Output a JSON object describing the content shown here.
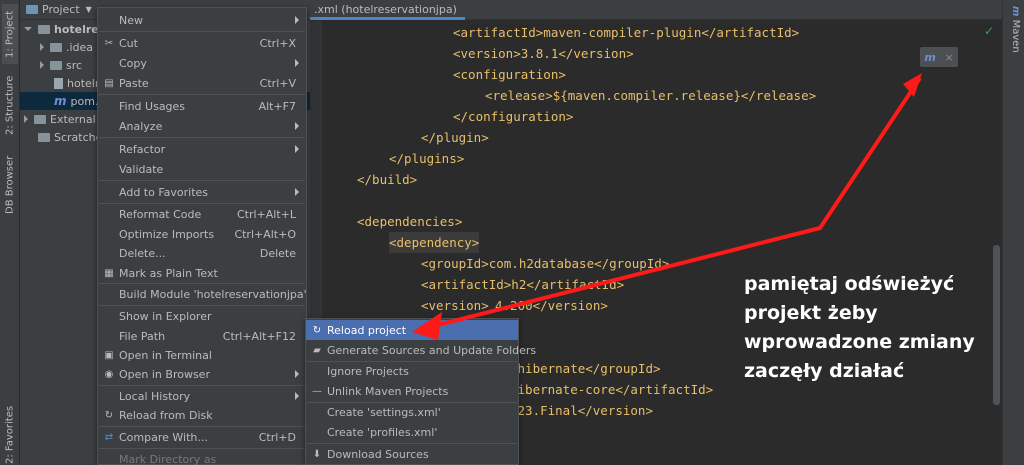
{
  "left_stripe": {
    "project_tab": "1: Project",
    "structure_tab": "2: Structure",
    "db_tab": "DB Browser",
    "favorites_tab": "2: Favorites"
  },
  "right_stripe": {
    "maven_tab": "Maven"
  },
  "project_panel": {
    "title": "Project",
    "tree": {
      "root": "hotelres",
      "idea": ".idea",
      "src": "src",
      "iml": "hotelr",
      "pom": "pom.x",
      "external": "External L",
      "scratches": "Scratches"
    }
  },
  "editor": {
    "tab_label": ".xml (hotelreservationjpa)",
    "lines": {
      "l1": "<artifactId>maven-compiler-plugin</artifactId>",
      "l2": "<version>3.8.1</version>",
      "l3": "<configuration>",
      "l4": "<release>${maven.compiler.release}</release>",
      "l5": "</configuration>",
      "l6": "</plugin>",
      "l7": "</plugins>",
      "l8": "</build>",
      "l9": "<dependencies>",
      "l10": "<dependency>",
      "l11": "<groupId>com.h2database</groupId>",
      "l12": "<artifactId>h2</artifactId>",
      "l13_a": "<version>",
      "l13_b": "4.200</version>",
      "l15": ".hibernate</groupId>",
      "l16": "hibernate-core</artifactId>",
      "l17": ".23.Final</version>"
    },
    "popup_close": "×",
    "status_check": "✓"
  },
  "context_menu": {
    "items": {
      "new": "New",
      "cut": "Cut",
      "cut_sc": "Ctrl+X",
      "copy": "Copy",
      "paste": "Paste",
      "paste_sc": "Ctrl+V",
      "find_usages": "Find Usages",
      "find_usages_sc": "Alt+F7",
      "analyze": "Analyze",
      "refactor": "Refactor",
      "validate": "Validate",
      "add_favorites": "Add to Favorites",
      "reformat": "Reformat Code",
      "reformat_sc": "Ctrl+Alt+L",
      "optimize": "Optimize Imports",
      "optimize_sc": "Ctrl+Alt+O",
      "delete": "Delete...",
      "delete_sc": "Delete",
      "plain_text": "Mark as Plain Text",
      "build_module": "Build Module 'hotelreservationjpa'",
      "show_explorer": "Show in Explorer",
      "file_path": "File Path",
      "file_path_sc": "Ctrl+Alt+F12",
      "open_terminal": "Open in Terminal",
      "open_browser": "Open in Browser",
      "local_history": "Local History",
      "reload_disk": "Reload from Disk",
      "compare": "Compare With...",
      "compare_sc": "Ctrl+D",
      "mark_dir": "Mark Directory as"
    }
  },
  "maven_submenu": {
    "items": {
      "reload": "Reload project",
      "generate": "Generate Sources and Update Folders",
      "ignore": "Ignore Projects",
      "unlink": "Unlink Maven Projects",
      "create_settings": "Create 'settings.xml'",
      "create_profiles": "Create 'profiles.xml'",
      "download": "Download Sources"
    }
  },
  "annotation": {
    "line1": "pamiętaj odświeżyć",
    "line2": "projekt żeby",
    "line3": "wprowadzone zmiany",
    "line4": "zaczęły działać"
  },
  "colors": {
    "arrow": "#ff1a1a",
    "highlight": "#4b6eaf",
    "tag": "#e8bf6a"
  }
}
